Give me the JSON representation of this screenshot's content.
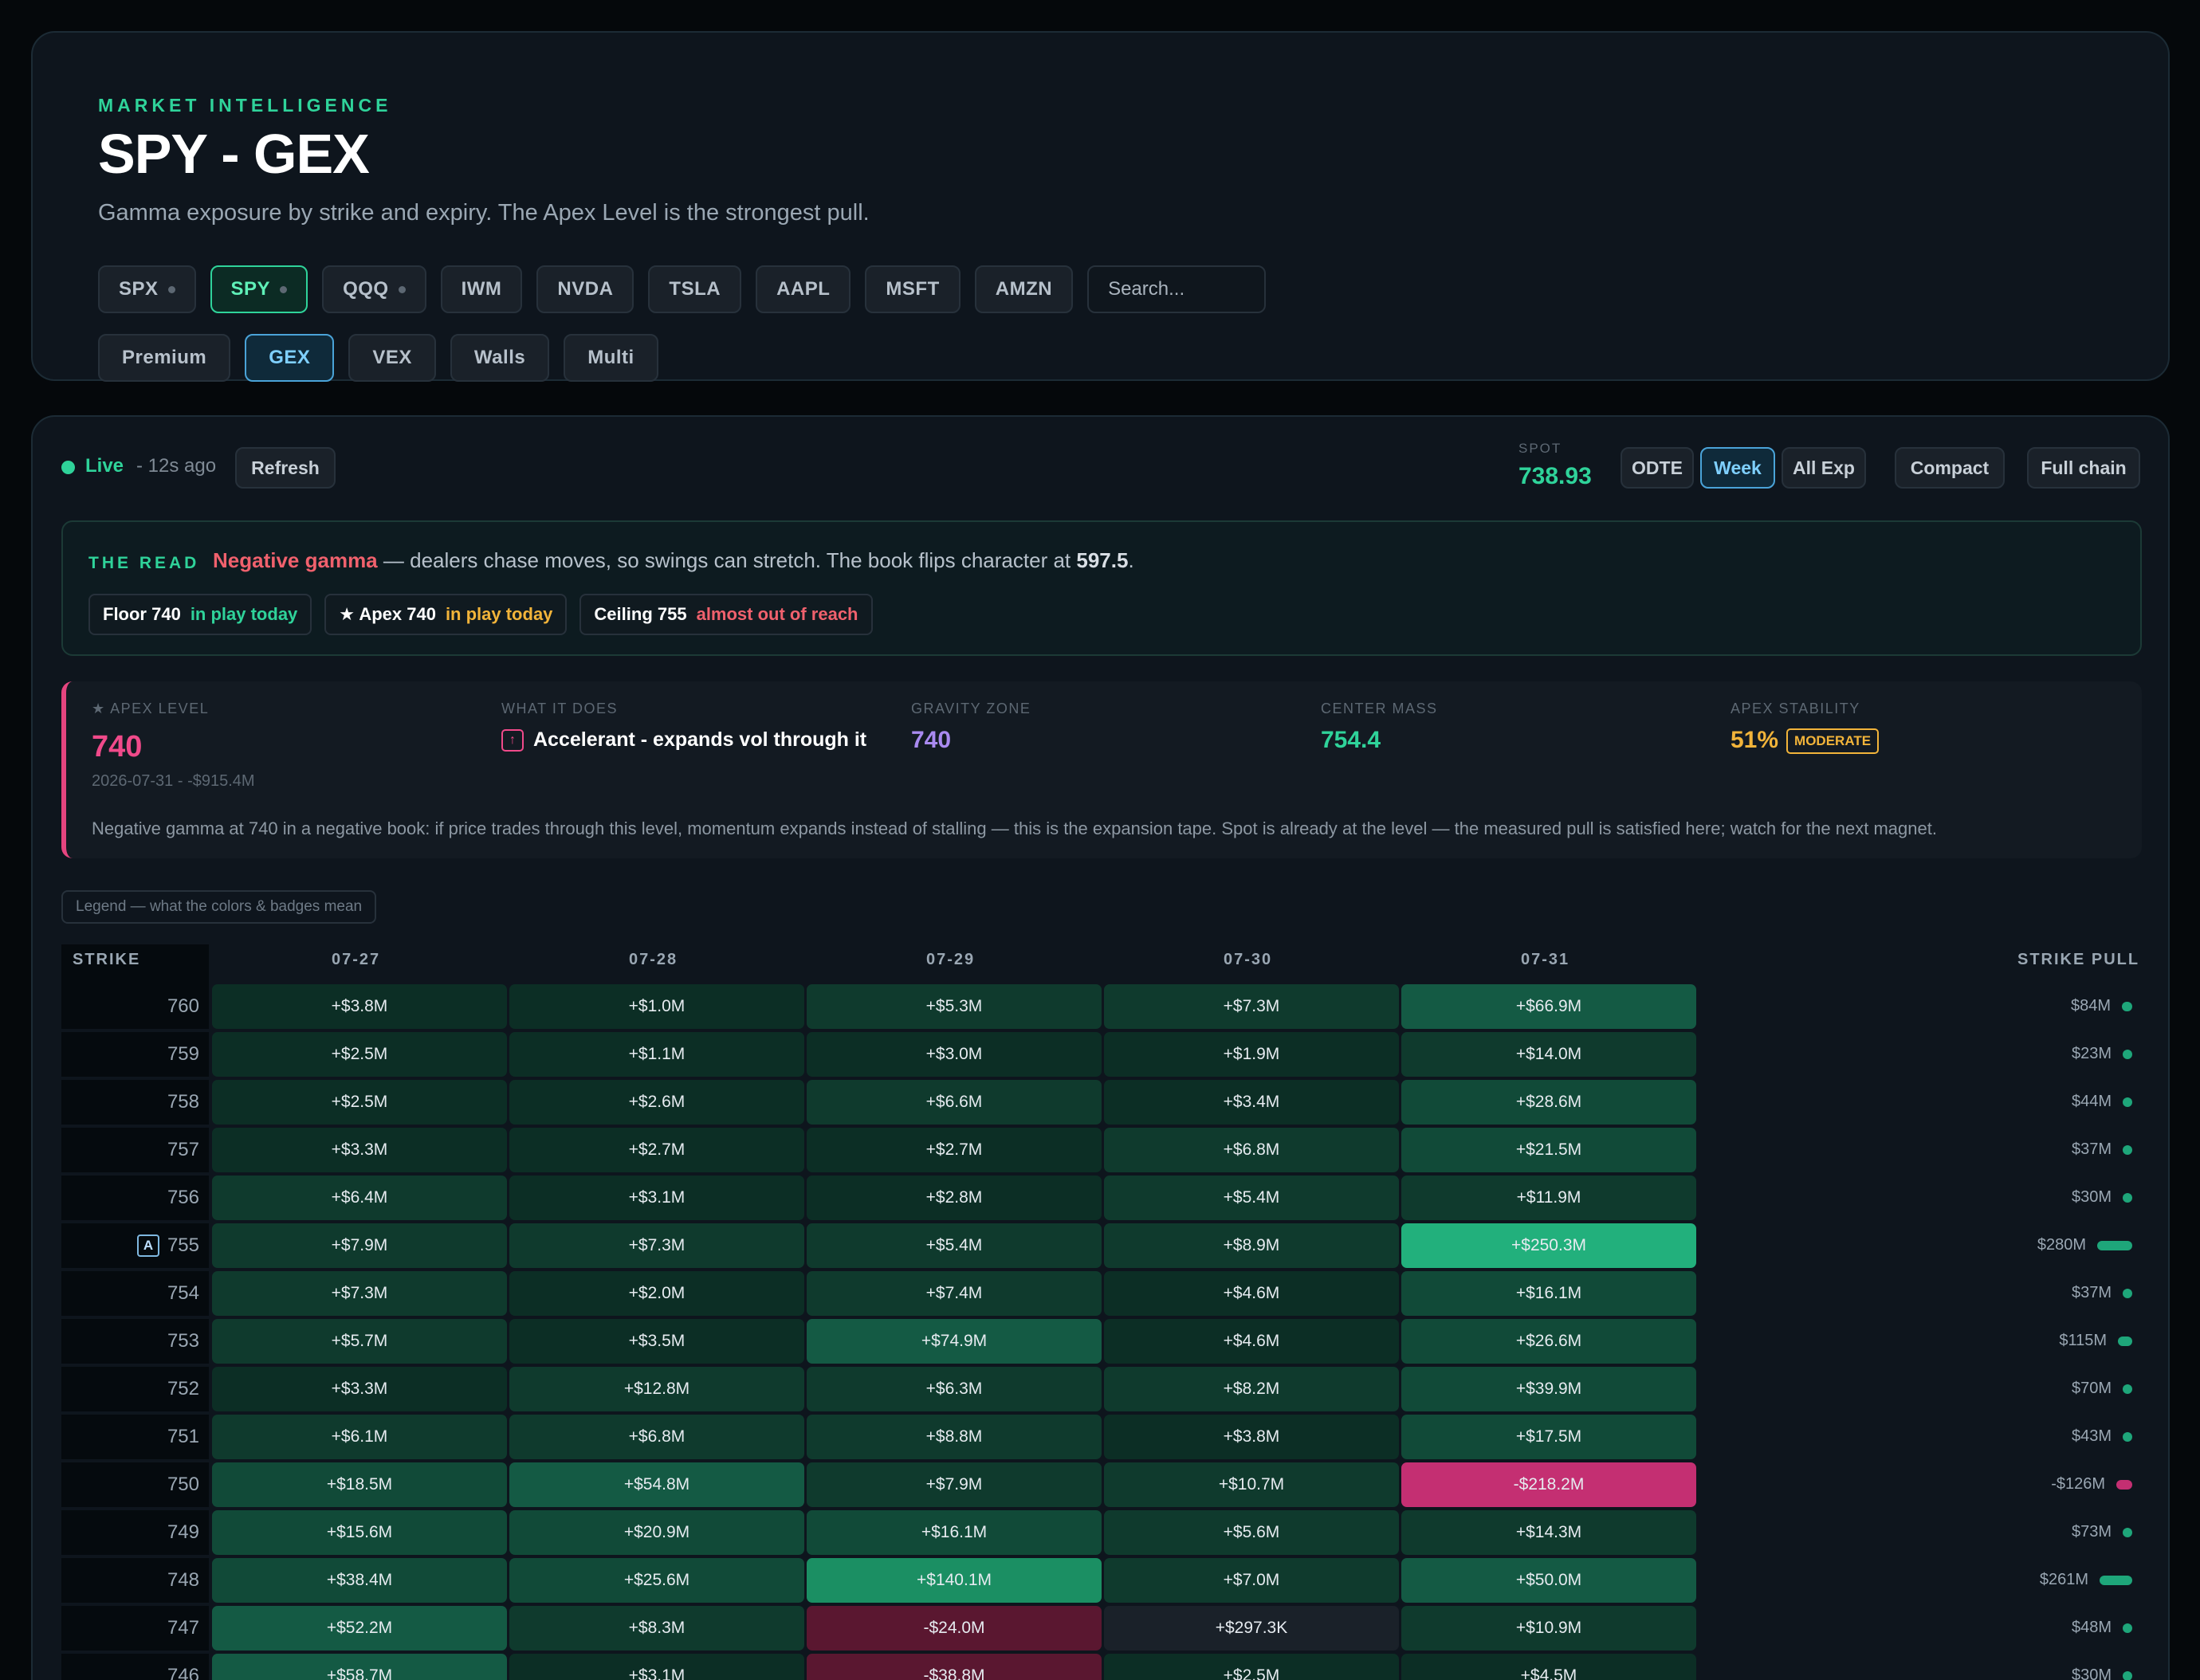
{
  "header": {
    "eyebrow": "MARKET INTELLIGENCE",
    "title": "SPY - GEX",
    "subtitle": "Gamma exposure by strike and expiry. The Apex Level is the strongest pull.",
    "tickers": [
      {
        "label": "SPX",
        "dot": true,
        "active": false
      },
      {
        "label": "SPY",
        "dot": true,
        "active": true
      },
      {
        "label": "QQQ",
        "dot": true,
        "active": false
      },
      {
        "label": "IWM",
        "dot": false,
        "active": false
      },
      {
        "label": "NVDA",
        "dot": false,
        "active": false
      },
      {
        "label": "TSLA",
        "dot": false,
        "active": false
      },
      {
        "label": "AAPL",
        "dot": false,
        "active": false
      },
      {
        "label": "MSFT",
        "dot": false,
        "active": false
      },
      {
        "label": "AMZN",
        "dot": false,
        "active": false
      }
    ],
    "search_placeholder": "Search...",
    "views": [
      {
        "label": "Premium",
        "active": false
      },
      {
        "label": "GEX",
        "active": true
      },
      {
        "label": "VEX",
        "active": false
      },
      {
        "label": "Walls",
        "active": false
      },
      {
        "label": "Multi",
        "active": false
      }
    ]
  },
  "status": {
    "live_label": "Live",
    "ago": "- 12s ago",
    "refresh_label": "Refresh",
    "spot_label": "SPOT",
    "spot_value": "738.93",
    "expiry_filters": {
      "odte": "ODTE",
      "week": "Week",
      "all": "All Exp"
    },
    "compact_label": "Compact",
    "full_chain_label": "Full chain"
  },
  "read": {
    "label": "THE READ",
    "headline": "Negative gamma",
    "body": " — dealers chase moves, so swings can stretch. The book flips character at ",
    "flip": "597.5",
    "tail": ".",
    "chips": [
      {
        "name": "Floor 740",
        "status": "in play today",
        "tone": "green"
      },
      {
        "name": "★ Apex 740",
        "status": "in play today",
        "tone": "gold"
      },
      {
        "name": "Ceiling 755",
        "status": "almost out of reach",
        "tone": "red"
      }
    ]
  },
  "apex": {
    "level_label": "★ APEX LEVEL",
    "level": "740",
    "level_sub": "2026-07-31 - -$915.4M",
    "what_label": "WHAT IT DOES",
    "what_value": "Accelerant - expands vol through it",
    "gravity_label": "GRAVITY ZONE",
    "gravity_value": "740",
    "center_label": "CENTER MASS",
    "center_value": "754.4",
    "stability_label": "APEX STABILITY",
    "stability_value": "51%",
    "stability_badge": "MODERATE",
    "description": "Negative gamma at 740 in a negative book: if price trades through this level, momentum expands instead of stalling — this is the expansion tape. Spot is already at the level — the measured pull is satisfied here; watch for the next magnet.",
    "colors": {
      "accent": "#f04a8a",
      "gravity": "#a98af0",
      "center": "#2fd39a",
      "stability": "#f2b43a"
    }
  },
  "legend_label": "Legend — what the colors & badges mean",
  "table": {
    "strike_header": "STRIKE",
    "pull_header": "STRIKE PULL",
    "expiries": [
      "07-27",
      "07-28",
      "07-29",
      "07-30",
      "07-31"
    ],
    "rows": [
      {
        "strike": "760",
        "apex": false,
        "cells": [
          "+$3.8M",
          "+$1.0M",
          "+$5.3M",
          "+$7.3M",
          "+$66.9M"
        ],
        "values": [
          3.8,
          1.0,
          5.3,
          7.3,
          66.9
        ],
        "pull": "$84M",
        "pull_value": 84
      },
      {
        "strike": "759",
        "apex": false,
        "cells": [
          "+$2.5M",
          "+$1.1M",
          "+$3.0M",
          "+$1.9M",
          "+$14.0M"
        ],
        "values": [
          2.5,
          1.1,
          3.0,
          1.9,
          14.0
        ],
        "pull": "$23M",
        "pull_value": 23
      },
      {
        "strike": "758",
        "apex": false,
        "cells": [
          "+$2.5M",
          "+$2.6M",
          "+$6.6M",
          "+$3.4M",
          "+$28.6M"
        ],
        "values": [
          2.5,
          2.6,
          6.6,
          3.4,
          28.6
        ],
        "pull": "$44M",
        "pull_value": 44
      },
      {
        "strike": "757",
        "apex": false,
        "cells": [
          "+$3.3M",
          "+$2.7M",
          "+$2.7M",
          "+$6.8M",
          "+$21.5M"
        ],
        "values": [
          3.3,
          2.7,
          2.7,
          6.8,
          21.5
        ],
        "pull": "$37M",
        "pull_value": 37
      },
      {
        "strike": "756",
        "apex": false,
        "cells": [
          "+$6.4M",
          "+$3.1M",
          "+$2.8M",
          "+$5.4M",
          "+$11.9M"
        ],
        "values": [
          6.4,
          3.1,
          2.8,
          5.4,
          11.9
        ],
        "pull": "$30M",
        "pull_value": 30
      },
      {
        "strike": "755",
        "apex": true,
        "cells": [
          "+$7.9M",
          "+$7.3M",
          "+$5.4M",
          "+$8.9M",
          "+$250.3M"
        ],
        "values": [
          7.9,
          7.3,
          5.4,
          8.9,
          250.3
        ],
        "pull": "$280M",
        "pull_value": 280
      },
      {
        "strike": "754",
        "apex": false,
        "cells": [
          "+$7.3M",
          "+$2.0M",
          "+$7.4M",
          "+$4.6M",
          "+$16.1M"
        ],
        "values": [
          7.3,
          2.0,
          7.4,
          4.6,
          16.1
        ],
        "pull": "$37M",
        "pull_value": 37
      },
      {
        "strike": "753",
        "apex": false,
        "cells": [
          "+$5.7M",
          "+$3.5M",
          "+$74.9M",
          "+$4.6M",
          "+$26.6M"
        ],
        "values": [
          5.7,
          3.5,
          74.9,
          4.6,
          26.6
        ],
        "pull": "$115M",
        "pull_value": 115
      },
      {
        "strike": "752",
        "apex": false,
        "cells": [
          "+$3.3M",
          "+$12.8M",
          "+$6.3M",
          "+$8.2M",
          "+$39.9M"
        ],
        "values": [
          3.3,
          12.8,
          6.3,
          8.2,
          39.9
        ],
        "pull": "$70M",
        "pull_value": 70
      },
      {
        "strike": "751",
        "apex": false,
        "cells": [
          "+$6.1M",
          "+$6.8M",
          "+$8.8M",
          "+$3.8M",
          "+$17.5M"
        ],
        "values": [
          6.1,
          6.8,
          8.8,
          3.8,
          17.5
        ],
        "pull": "$43M",
        "pull_value": 43
      },
      {
        "strike": "750",
        "apex": false,
        "cells": [
          "+$18.5M",
          "+$54.8M",
          "+$7.9M",
          "+$10.7M",
          "-$218.2M"
        ],
        "values": [
          18.5,
          54.8,
          7.9,
          10.7,
          -218.2
        ],
        "pull": "-$126M",
        "pull_value": -126
      },
      {
        "strike": "749",
        "apex": false,
        "cells": [
          "+$15.6M",
          "+$20.9M",
          "+$16.1M",
          "+$5.6M",
          "+$14.3M"
        ],
        "values": [
          15.6,
          20.9,
          16.1,
          5.6,
          14.3
        ],
        "pull": "$73M",
        "pull_value": 73
      },
      {
        "strike": "748",
        "apex": false,
        "cells": [
          "+$38.4M",
          "+$25.6M",
          "+$140.1M",
          "+$7.0M",
          "+$50.0M"
        ],
        "values": [
          38.4,
          25.6,
          140.1,
          7.0,
          50.0
        ],
        "pull": "$261M",
        "pull_value": 261
      },
      {
        "strike": "747",
        "apex": false,
        "cells": [
          "+$52.2M",
          "+$8.3M",
          "-$24.0M",
          "+$297.3K",
          "+$10.9M"
        ],
        "values": [
          52.2,
          8.3,
          -24.0,
          0.3,
          10.9
        ],
        "pull": "$48M",
        "pull_value": 48
      },
      {
        "strike": "746",
        "apex": false,
        "cells": [
          "+$58.7M",
          "+$3.1M",
          "-$38.8M",
          "+$2.5M",
          "+$4.5M"
        ],
        "values": [
          58.7,
          3.1,
          -38.8,
          2.5,
          4.5
        ],
        "pull": "$30M",
        "pull_value": 30
      }
    ]
  }
}
